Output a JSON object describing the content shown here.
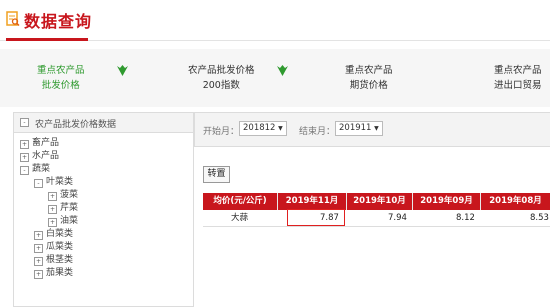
{
  "header": {
    "title": "数据查询"
  },
  "nav": {
    "items": [
      {
        "line1": "重点农产品",
        "line2": "批发价格",
        "active": true
      },
      {
        "line1": "农产品批发价格",
        "line2": "200指数",
        "active": false
      },
      {
        "line1": "重点农产品",
        "line2": "期货价格",
        "active": false
      },
      {
        "line1": "重点农产品",
        "line2": "进出口贸易",
        "active": false
      }
    ],
    "icon": "wheat-icon"
  },
  "sidebar": {
    "header": "农产品批发价格数据",
    "tree": [
      {
        "label": "畜产品",
        "toggle": "+"
      },
      {
        "label": "水产品",
        "toggle": "+"
      },
      {
        "label": "蔬菜",
        "toggle": "-"
      },
      {
        "label": "叶菜类",
        "toggle": "-"
      },
      {
        "label": "菠菜",
        "toggle": "+"
      },
      {
        "label": "芹菜",
        "toggle": "+"
      },
      {
        "label": "油菜",
        "toggle": "+"
      },
      {
        "label": "白菜类",
        "toggle": "+"
      },
      {
        "label": "瓜菜类",
        "toggle": "+"
      },
      {
        "label": "根茎类",
        "toggle": "+"
      },
      {
        "label": "茄果类",
        "toggle": "+"
      }
    ]
  },
  "filter": {
    "start_label": "开始月：",
    "start_value": "201812",
    "end_label": "结束月：",
    "end_value": "201911",
    "caret": "▼"
  },
  "swap_button": "转置",
  "table": {
    "headers": [
      "均价(元/公斤)",
      "2019年11月",
      "2019年10月",
      "2019年09月",
      "2019年08月"
    ],
    "rows": [
      {
        "name": "大蒜",
        "values": [
          "7.87",
          "7.94",
          "8.12",
          "8.53"
        ]
      }
    ]
  },
  "colors": {
    "brand": "#c8161d",
    "active_nav": "#2f9a2f",
    "highlight": "#e02020"
  }
}
